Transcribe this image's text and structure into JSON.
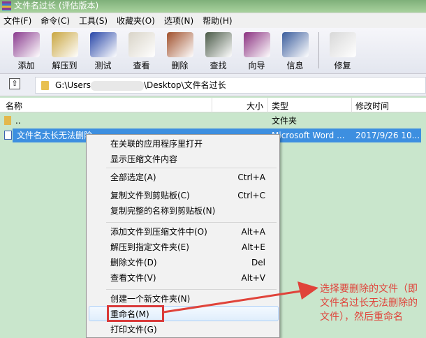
{
  "title": "文件名过长 (评估版本)",
  "menu": [
    "文件(F)",
    "命令(C)",
    "工具(S)",
    "收藏夹(O)",
    "选项(N)",
    "帮助(H)"
  ],
  "toolbar": [
    {
      "label": "添加",
      "icon": "add-archive-icon",
      "color": "#8a3b8f"
    },
    {
      "label": "解压到",
      "icon": "extract-icon",
      "color": "#c9a640"
    },
    {
      "label": "测试",
      "icon": "test-icon",
      "color": "#2846a8"
    },
    {
      "label": "查看",
      "icon": "view-icon",
      "color": "#d9d4c8"
    },
    {
      "label": "删除",
      "icon": "delete-icon",
      "color": "#a0502c"
    },
    {
      "label": "查找",
      "icon": "find-icon",
      "color": "#4a5a48"
    },
    {
      "label": "向导",
      "icon": "wizard-icon",
      "color": "#8a3080"
    },
    {
      "label": "信息",
      "icon": "info-icon",
      "color": "#3a5c9c"
    },
    {
      "label": "修复",
      "icon": "repair-icon",
      "color": "#d8d8d8"
    }
  ],
  "address": {
    "prefix": "G:\\Users",
    "suffix": "\\Desktop\\文件名过长"
  },
  "columns": {
    "name": "名称",
    "size": "大小",
    "type": "类型",
    "modified": "修改时间"
  },
  "rows": [
    {
      "name": "..",
      "type": "文件夹"
    },
    {
      "name": "文件名太长无法删除",
      "type": "Microsoft Word ...",
      "modified": "2017/9/26 10..."
    }
  ],
  "context_menu": [
    {
      "label": "在关联的应用程序里打开",
      "shortcut": ""
    },
    {
      "label": "显示压缩文件内容",
      "shortcut": ""
    },
    {
      "label": "全部选定(A)",
      "shortcut": "Ctrl+A"
    },
    {
      "label": "复制文件到剪贴板(C)",
      "shortcut": "Ctrl+C"
    },
    {
      "label": "复制完整的名称到剪贴板(N)",
      "shortcut": ""
    },
    {
      "label": "添加文件到压缩文件中(O)",
      "shortcut": "Alt+A"
    },
    {
      "label": "解压到指定文件夹(E)",
      "shortcut": "Alt+E"
    },
    {
      "label": "删除文件(D)",
      "shortcut": "Del"
    },
    {
      "label": "查看文件(V)",
      "shortcut": "Alt+V"
    },
    {
      "label": "创建一个新文件夹(N)",
      "shortcut": ""
    },
    {
      "label": "重命名(M)",
      "shortcut": ""
    },
    {
      "label": "打印文件(G)",
      "shortcut": ""
    }
  ],
  "annotation": "选择要删除的文件（即文件名过长无法删除的文件），然后重命名",
  "accent": "#d93a3a"
}
